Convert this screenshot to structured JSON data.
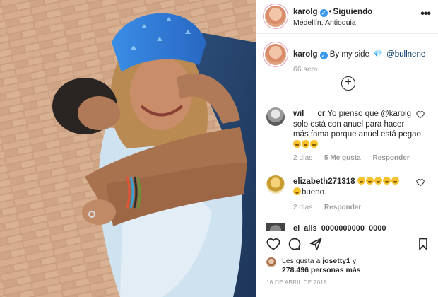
{
  "post": {
    "username": "karolg",
    "follow_label": "Siguiendo",
    "location": "Medellín, Antioquia",
    "more_label": "•••"
  },
  "caption": {
    "username": "karolg",
    "text_before": "By my side",
    "mention": "@bullnene",
    "time": "66 sem"
  },
  "add_more_label": "+",
  "comments": [
    {
      "username": "wil___cr",
      "text": "Yo pienso que @karolg solo está con anuel para hacer más fama porque anuel está pegao",
      "time": "2 días",
      "likes": "5 Me gusta",
      "reply": "Responder"
    },
    {
      "username": "elizabeth271318",
      "text": "bueno",
      "time": "2 días",
      "reply": "Responder"
    }
  ],
  "partial_comment": "el_alis_0000000000_0000",
  "likes": {
    "line1_prefix": "Les gusta a",
    "line1_user": "josetty1",
    "line1_suffix": "y",
    "line2_count": "278.496",
    "line2_suffix": "personas más"
  },
  "date": "16 DE ABRIL DE 2018",
  "icons": {
    "verified": "verified-badge-icon",
    "gem": "gem-icon",
    "heart": "heart-icon",
    "comment": "comment-icon",
    "share": "share-icon",
    "save": "bookmark-icon"
  },
  "colors": {
    "verified": "#3897f0",
    "link": "#003569",
    "muted": "#999999",
    "bandana": "#2f7fd6"
  }
}
